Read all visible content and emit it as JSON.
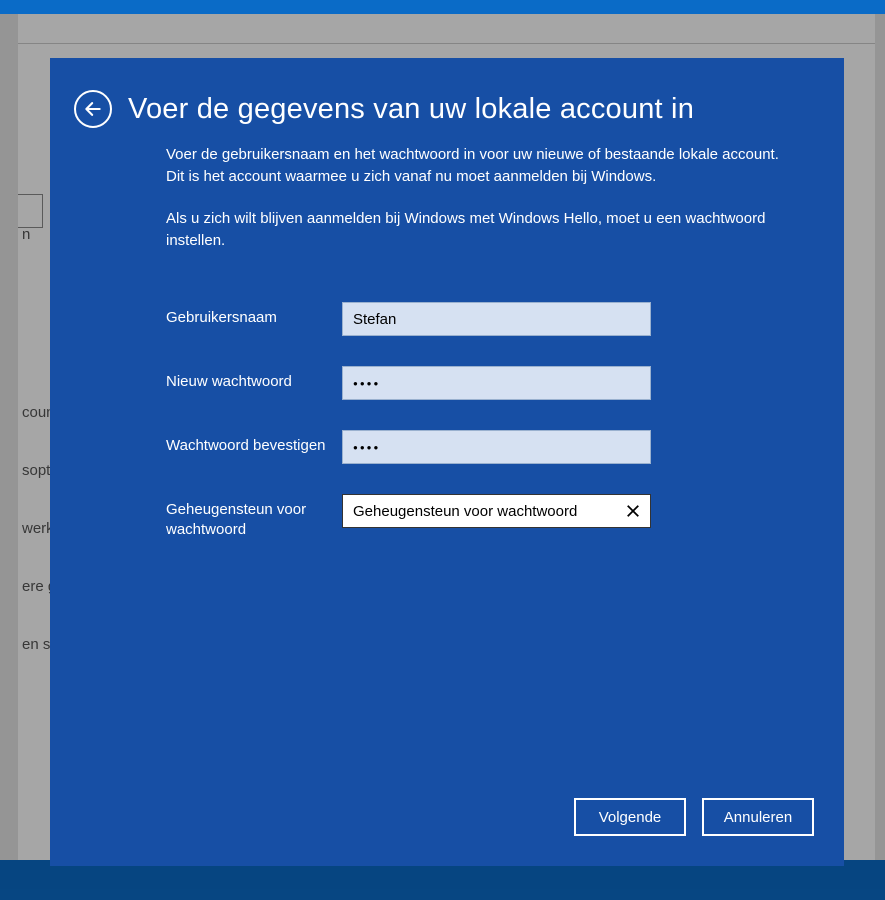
{
  "background": {
    "sidebar_items": [
      "n",
      "counts",
      "sopties",
      "werk o",
      "ere ge",
      "en syn"
    ]
  },
  "modal": {
    "title": "Voer de gegevens van uw lokale account in",
    "desc1": "Voer de gebruikersnaam en het wachtwoord in voor uw nieuwe of bestaande lokale account. Dit is het account waarmee u zich vanaf nu moet aanmelden bij Windows.",
    "desc2": "Als u zich wilt blijven aanmelden bij Windows met Windows Hello, moet u een wachtwoord instellen.",
    "labels": {
      "username": "Gebruikersnaam",
      "newpassword": "Nieuw wachtwoord",
      "confirmpassword": "Wachtwoord bevestigen",
      "hint": "Geheugensteun voor wachtwoord"
    },
    "values": {
      "username": "Stefan",
      "newpassword_masked": "●●●●",
      "confirmpassword_masked": "●●●●",
      "hint": "Geheugensteun voor wachtwoord"
    },
    "buttons": {
      "next": "Volgende",
      "cancel": "Annuleren"
    }
  }
}
